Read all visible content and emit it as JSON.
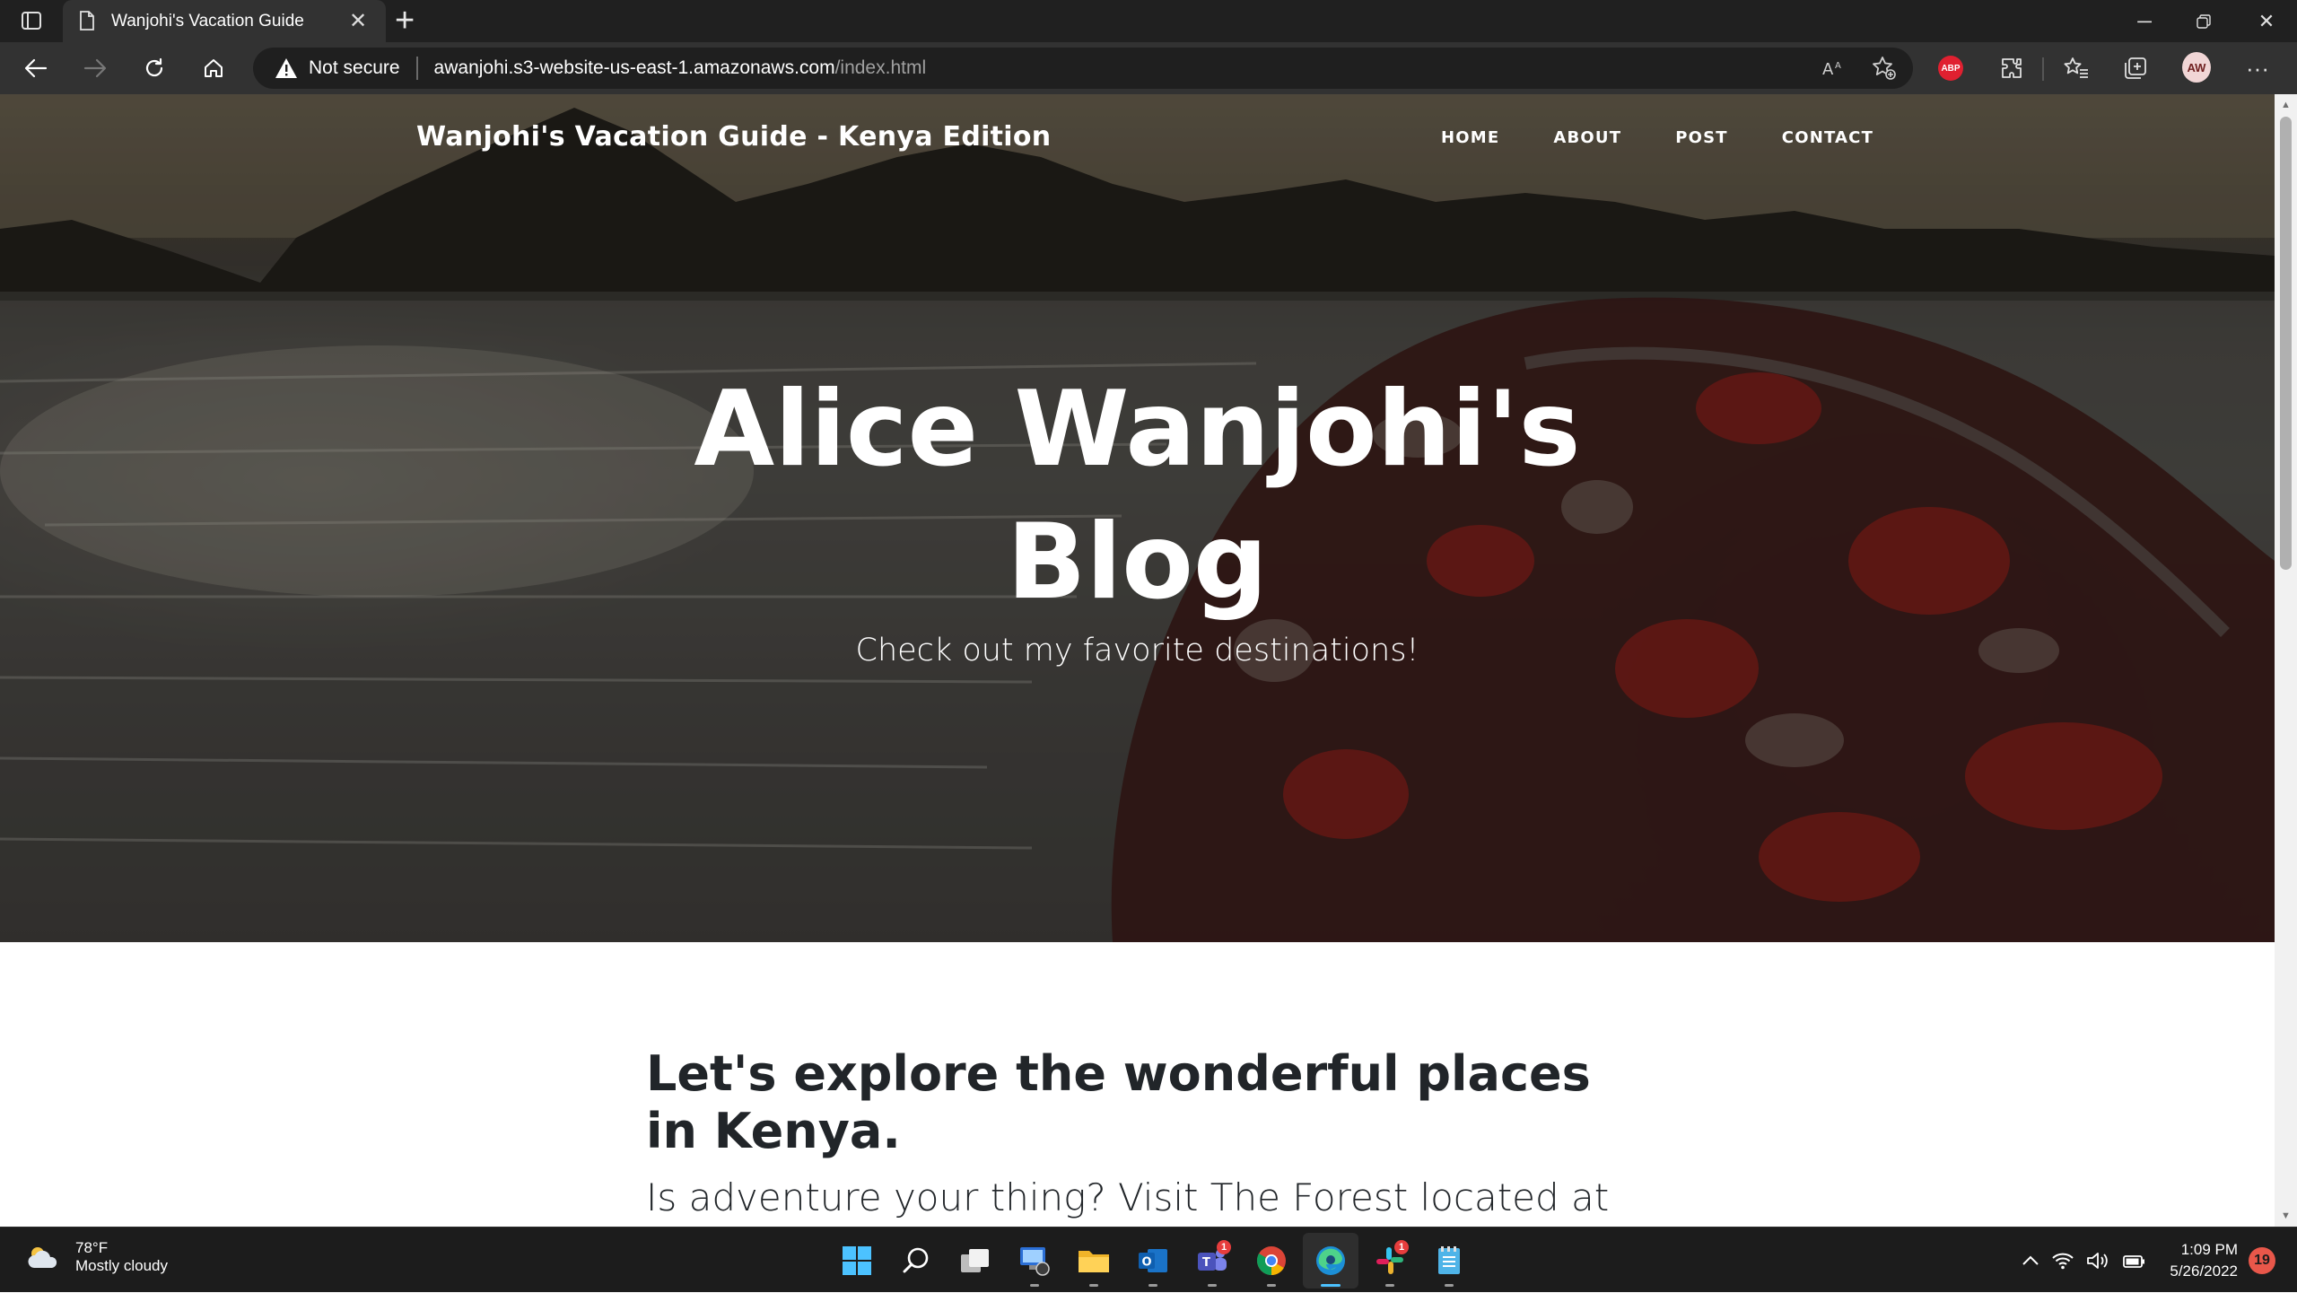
{
  "browser": {
    "tab_title": "Wanjohi's Vacation Guide",
    "security_label": "Not secure",
    "url_host": "awanjohi.s3-website-us-east-1.amazonaws.com",
    "url_path": "/index.html",
    "abp_label": "ABP",
    "profile_initials": "AW"
  },
  "site": {
    "brand": "Wanjohi's Vacation Guide - Kenya Edition",
    "nav": [
      "HOME",
      "ABOUT",
      "POST",
      "CONTACT"
    ],
    "hero_title_line1": "Alice Wanjohi's",
    "hero_title_line2": "Blog",
    "hero_subtitle": "Check out my favorite destinations!",
    "post_heading": "Let's explore the wonderful places in Kenya.",
    "post_text": "Is adventure your thing? Visit The Forest located at"
  },
  "taskbar": {
    "weather_temp": "78°F",
    "weather_desc": "Mostly cloudy",
    "apps": [
      {
        "name": "start",
        "icon": "windows-start-icon",
        "badge": ""
      },
      {
        "name": "search",
        "icon": "search-icon",
        "badge": ""
      },
      {
        "name": "task-view",
        "icon": "task-view-icon",
        "badge": ""
      },
      {
        "name": "remote-desktop",
        "icon": "remote-desktop-icon",
        "badge": ""
      },
      {
        "name": "file-explorer",
        "icon": "folder-icon",
        "badge": ""
      },
      {
        "name": "outlook",
        "icon": "outlook-icon",
        "badge": ""
      },
      {
        "name": "teams",
        "icon": "teams-icon",
        "badge": "1"
      },
      {
        "name": "chrome",
        "icon": "chrome-icon",
        "badge": ""
      },
      {
        "name": "edge",
        "icon": "edge-icon",
        "badge": ""
      },
      {
        "name": "slack",
        "icon": "slack-icon",
        "badge": "1"
      },
      {
        "name": "notepad",
        "icon": "notepad-icon",
        "badge": ""
      }
    ],
    "clock_time": "1:09 PM",
    "clock_date": "5/26/2022",
    "notification_count": "19"
  },
  "colors": {
    "tabbar_bg": "#202020",
    "toolbar_bg": "#323232",
    "taskbar_bg": "#1c1c1c",
    "edge_accent": "#4cc2ff",
    "abp_red": "#e02030",
    "page_text": "#212529"
  }
}
